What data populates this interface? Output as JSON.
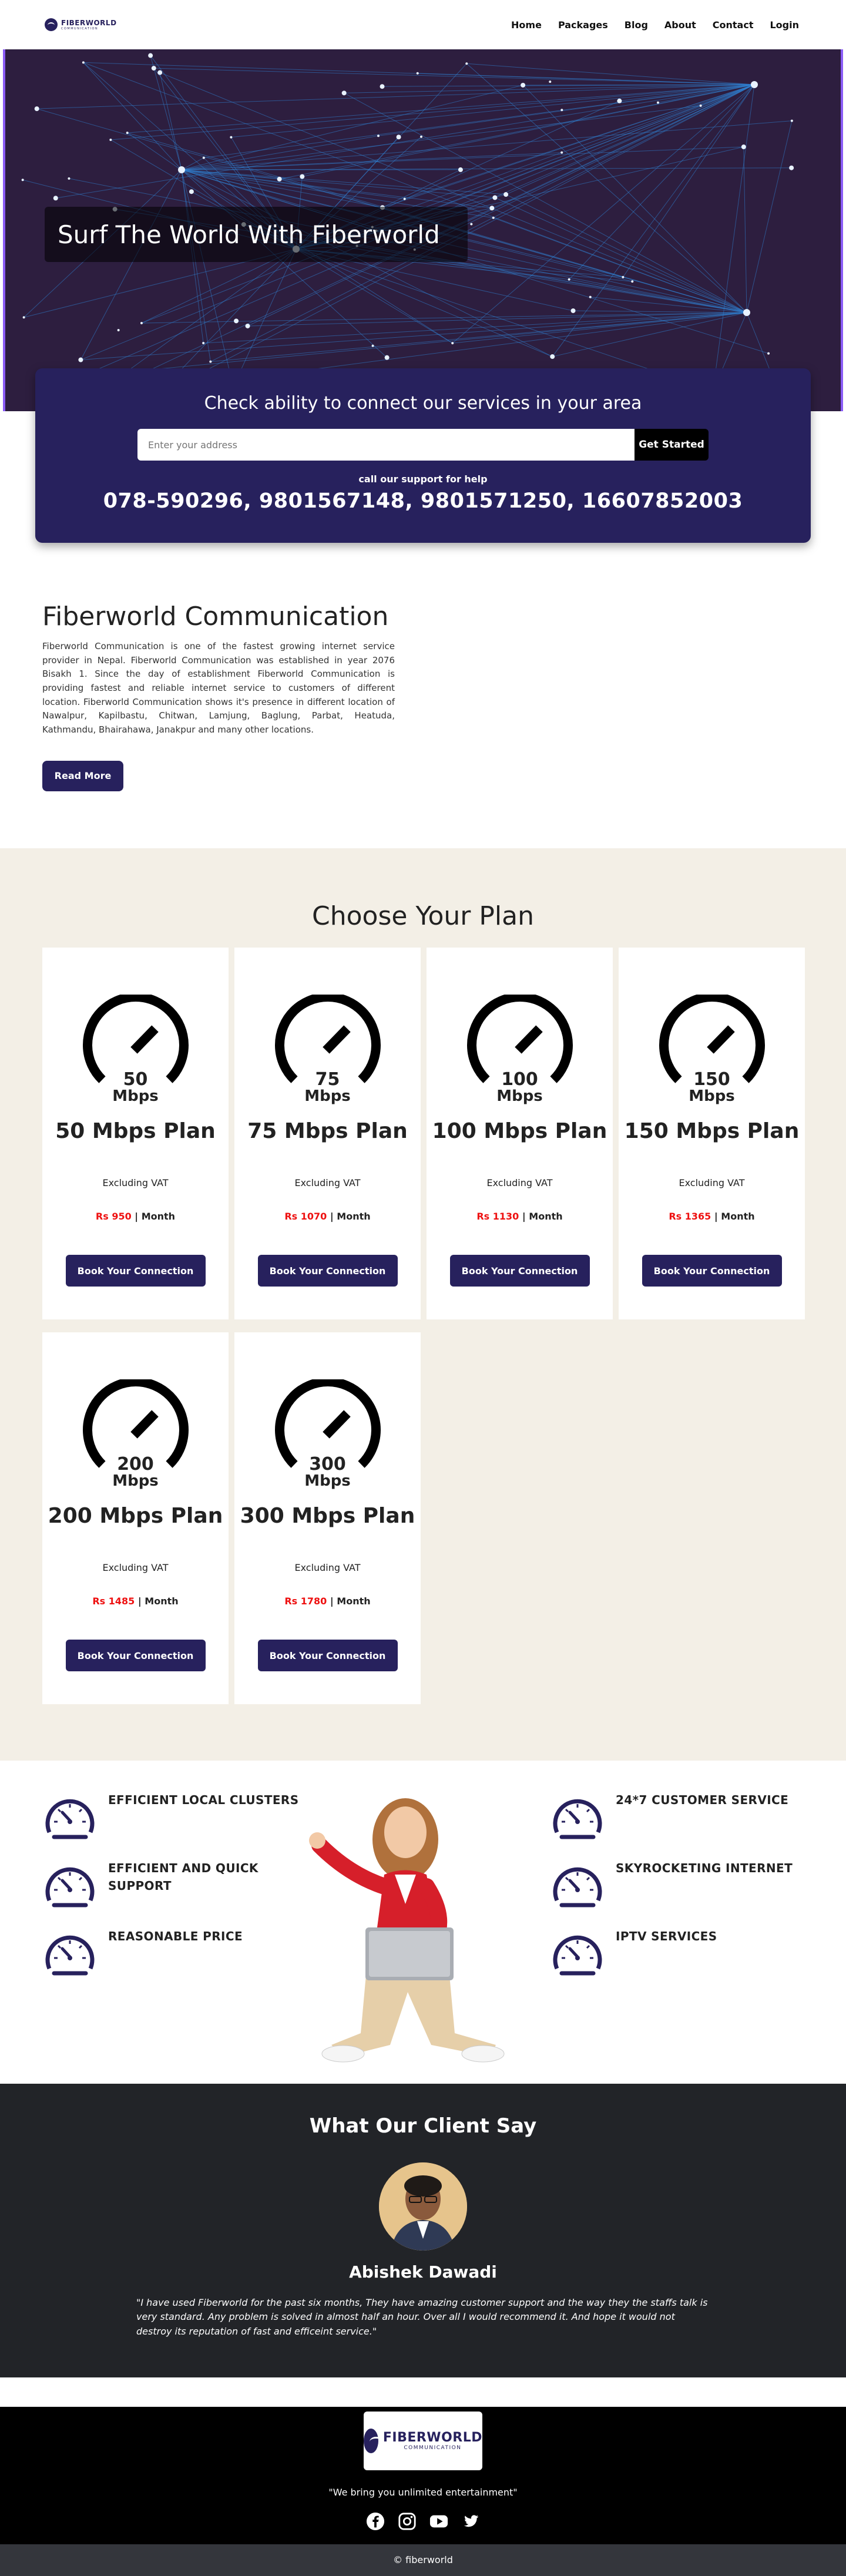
{
  "brand": {
    "name": "FIBERWORLD",
    "sub": "COMMUNICATION",
    "color": "#27215d"
  },
  "nav": {
    "items": [
      "Home",
      "Packages",
      "Blog",
      "About",
      "Contact",
      "Login"
    ]
  },
  "hero": {
    "title": "Surf The World With Fiberworld"
  },
  "check": {
    "heading": "Check ability to connect our services in your area",
    "placeholder": "Enter your address",
    "button": "Get Started",
    "support_label": "call our support for help",
    "phones": "078-590296, 9801567148, 9801571250, 16607852003"
  },
  "about": {
    "title": "Fiberworld Communication",
    "text": "Fiberworld Communication is one of the fastest growing internet service provider in Nepal. Fiberworld Communication was established in year 2076 Bisakh 1. Since the day of establishment Fiberworld Communication is providing fastest and reliable internet service to customers of different location. Fiberworld Communication shows it's presence in different location of Nawalpur, Kapilbastu, Chitwan, Lamjung, Baglung, Parbat, Heatuda, Kathmandu, Bhairahawa, Janakpur and many other locations.",
    "button": "Read More"
  },
  "plans": {
    "title": "Choose Your Plan",
    "unit": "Mbps",
    "vat": "Excluding VAT",
    "per": "Month",
    "button": "Book Your Connection",
    "items": [
      {
        "speed": "50",
        "name": "50 Mbps Plan",
        "price": "Rs 950"
      },
      {
        "speed": "75",
        "name": "75 Mbps Plan",
        "price": "Rs 1070"
      },
      {
        "speed": "100",
        "name": "100 Mbps Plan",
        "price": "Rs 1130"
      },
      {
        "speed": "150",
        "name": "150 Mbps Plan",
        "price": "Rs 1365"
      },
      {
        "speed": "200",
        "name": "200 Mbps Plan",
        "price": "Rs 1485"
      },
      {
        "speed": "300",
        "name": "300 Mbps Plan",
        "price": "Rs 1780"
      }
    ]
  },
  "features": {
    "left": [
      "EFFICIENT LOCAL CLUSTERS",
      "EFFICIENT AND QUICK SUPPORT",
      "REASONABLE PRICE"
    ],
    "right": [
      "24*7 CUSTOMER SERVICE",
      "SKYROCKETING INTERNET",
      "IPTV SERVICES"
    ]
  },
  "testimonial": {
    "title": "What Our Client Say",
    "name": "Abishek Dawadi",
    "quote": "\"I have used Fiberworld for the past six months, They have amazing customer support and the way they the staffs talk is very standard. Any problem is solved in almost half an hour. Over all I would recommend it. And hope it would not destroy its reputation of fast and efficeint service.\""
  },
  "footer": {
    "tagline": "\"We bring you unlimited entertainment\"",
    "socials": [
      "facebook-icon",
      "instagram-icon",
      "youtube-icon",
      "twitter-icon"
    ],
    "copyright": "© fiberworld"
  }
}
